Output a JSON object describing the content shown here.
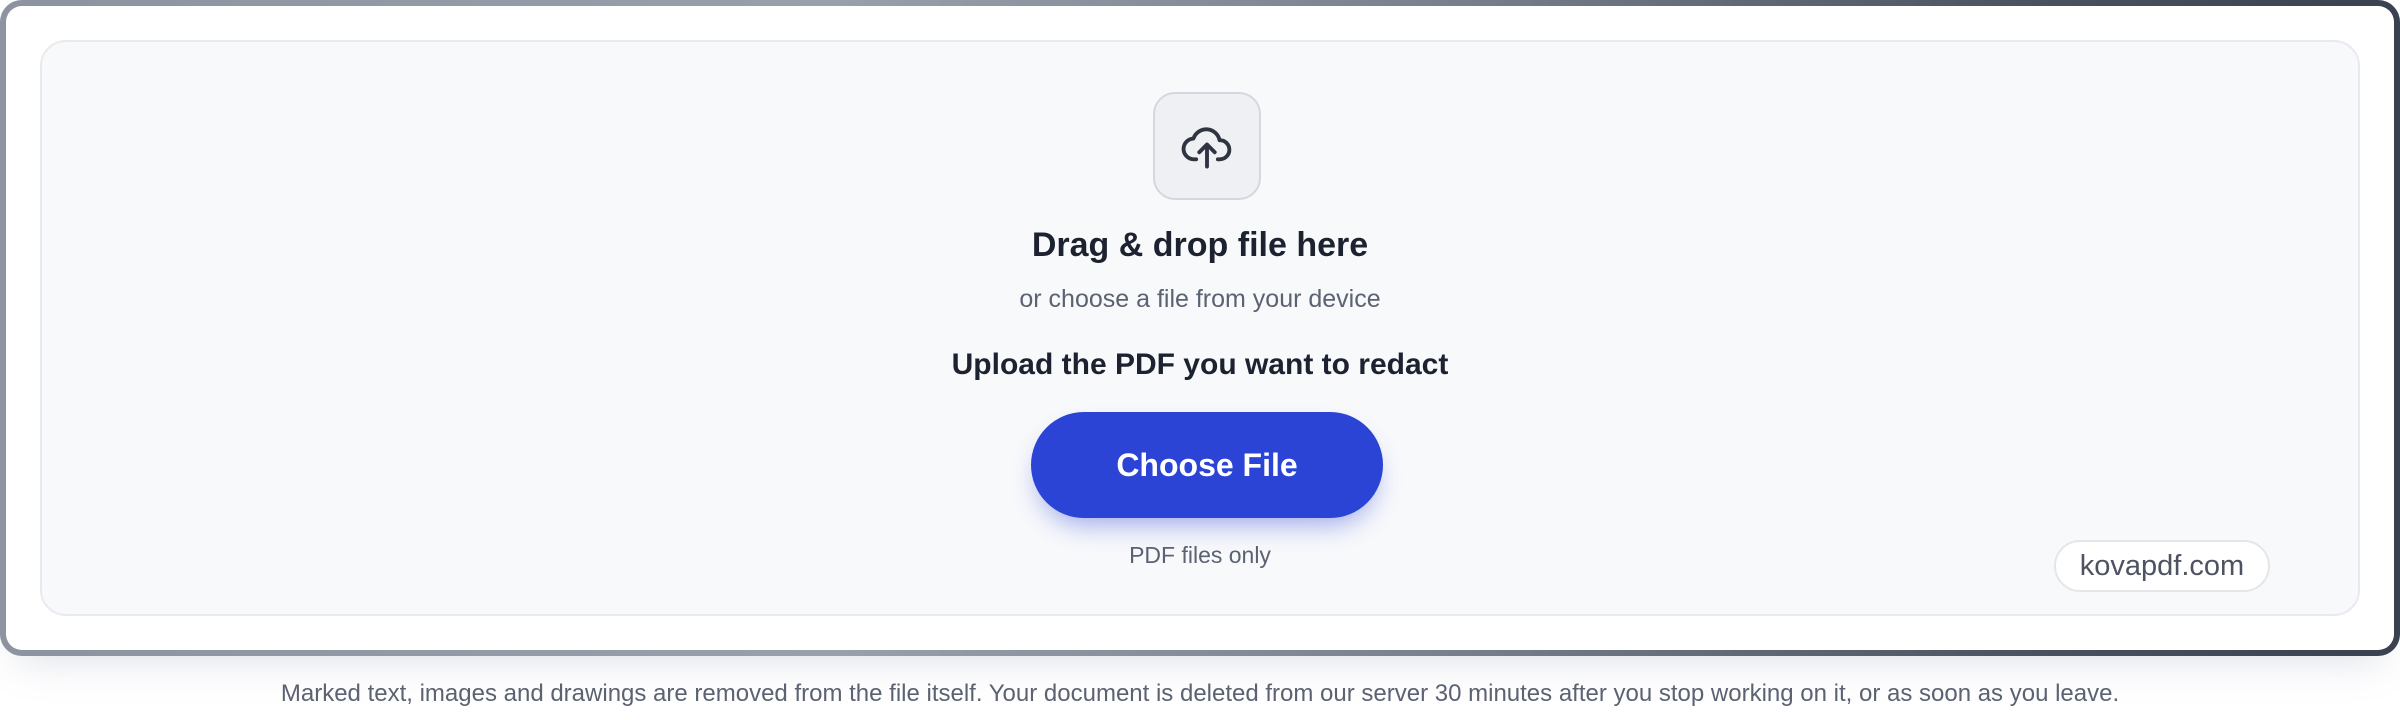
{
  "upload": {
    "icon": "cloud-upload-icon",
    "title": "Drag & drop file here",
    "subtitle": "or choose a file from your device",
    "instruction": "Upload the PDF you want to redact",
    "button_label": "Choose File",
    "hint": "PDF files only"
  },
  "watermark": {
    "text": "kovapdf.com"
  },
  "footer": {
    "note": "Marked text, images and drawings are removed from the file itself. Your document is deleted from our server 30 minutes after you stop working on it, or as soon as you leave."
  },
  "colors": {
    "accent": "#2b44d6",
    "dropzone_bg": "#f8f9fb",
    "text_dark": "#1d2230",
    "text_muted": "#5b6272"
  }
}
